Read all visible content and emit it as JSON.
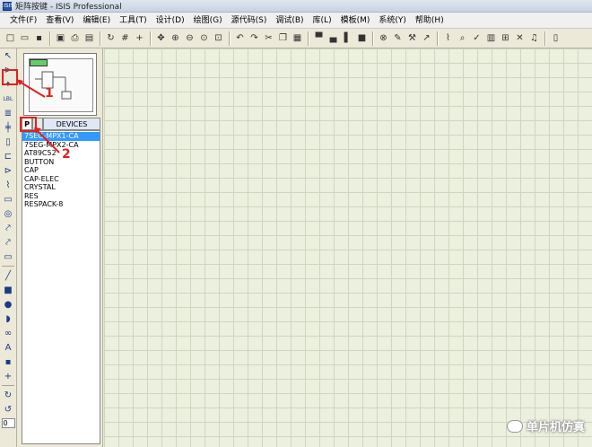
{
  "window": {
    "icon_text": "ISIS",
    "title": "矩阵按键 - ISIS Professional"
  },
  "menubar": {
    "items": [
      "文件(F)",
      "查看(V)",
      "编辑(E)",
      "工具(T)",
      "设计(D)",
      "绘图(G)",
      "源代码(S)",
      "调试(B)",
      "库(L)",
      "模板(M)",
      "系统(Y)",
      "帮助(H)"
    ]
  },
  "toolbar": {
    "icons": [
      [
        "new-file-icon",
        "□"
      ],
      [
        "open-folder-icon",
        "▭"
      ],
      [
        "save-icon",
        "▪"
      ],
      "sep",
      [
        "import-icon",
        "▣"
      ],
      [
        "print-icon",
        "⎙"
      ],
      [
        "print-area-icon",
        "▤"
      ],
      "sep",
      [
        "refresh-icon",
        "↻"
      ],
      [
        "grid-icon",
        "#"
      ],
      [
        "origin-icon",
        "+"
      ],
      "sep",
      [
        "pan-icon",
        "✥"
      ],
      [
        "zoom-in-icon",
        "⊕"
      ],
      [
        "zoom-out-icon",
        "⊖"
      ],
      [
        "zoom-all-icon",
        "⊙"
      ],
      [
        "zoom-area-icon",
        "⊡"
      ],
      "sep",
      [
        "undo-icon",
        "↶"
      ],
      [
        "redo-icon",
        "↷"
      ],
      [
        "cut-icon",
        "✂"
      ],
      [
        "copy-icon",
        "❐"
      ],
      [
        "paste-icon",
        "▦"
      ],
      "sep",
      [
        "block-copy-icon",
        "▀"
      ],
      [
        "block-move-icon",
        "▄"
      ],
      [
        "block-rotate-icon",
        "▌"
      ],
      [
        "block-delete-icon",
        "■"
      ],
      "sep",
      [
        "pick-icon",
        "⊗"
      ],
      [
        "make-device-icon",
        "✎"
      ],
      [
        "package-icon",
        "⚒"
      ],
      [
        "decompose-icon",
        "↗"
      ],
      "sep",
      [
        "wire-autorouter-icon",
        "⌇"
      ],
      [
        "search-tag-icon",
        "⌕"
      ],
      [
        "property-tool-icon",
        "✓"
      ],
      [
        "design-explorer-icon",
        "▥"
      ],
      [
        "new-sheet-icon",
        "⊞"
      ],
      [
        "delete-sheet-icon",
        "✕"
      ],
      [
        "goto-sheet-icon",
        "♫"
      ],
      "sep",
      [
        "bom-icon",
        "▯"
      ]
    ]
  },
  "left_toolbar": {
    "icons": [
      [
        "select-mode-icon",
        "↖"
      ],
      [
        "component-mode-icon",
        "⊳"
      ],
      [
        "junction-icon",
        "✦"
      ],
      [
        "wire-label-icon",
        "LBL"
      ],
      [
        "text-script-icon",
        "≣"
      ],
      [
        "bus-icon",
        "╪"
      ],
      [
        "subcircuit-icon",
        "▯"
      ],
      [
        "terminal-icon",
        "⊏"
      ],
      [
        "device-pin-icon",
        "⊳"
      ],
      [
        "graph-icon",
        "⌇"
      ],
      [
        "tape-recorder-icon",
        "▭"
      ],
      [
        "generator-icon",
        "◎"
      ],
      [
        "voltage-probe-icon",
        "⤤"
      ],
      [
        "current-probe-icon",
        "⤤"
      ],
      [
        "virtual-instrument-icon",
        "▭"
      ],
      "sep",
      [
        "line-icon",
        "╱"
      ],
      [
        "box-icon",
        "■"
      ],
      [
        "circle-icon",
        "●"
      ],
      [
        "arc-icon",
        "◗"
      ],
      [
        "path-icon",
        "∞"
      ],
      [
        "text-icon",
        "A"
      ],
      [
        "symbol-icon",
        "▪"
      ],
      [
        "marker-icon",
        "+"
      ],
      "sep",
      [
        "rotate-cw-icon",
        "↻"
      ],
      [
        "rotate-ccw-icon",
        "↺"
      ]
    ],
    "rotation_value": "0"
  },
  "panel": {
    "p_button": "P",
    "devices_label": "DEVICES",
    "devices": [
      "7SEG-MPX1-CA",
      "7SEG-MPX2-CA",
      "AT89C52",
      "BUTTON",
      "CAP",
      "CAP-ELEC",
      "CRYSTAL",
      "RES",
      "RESPACK-8"
    ],
    "selected_index": 0
  },
  "annotations": {
    "label_1": "1",
    "label_2": "2",
    "color": "#e02020"
  },
  "watermark": {
    "text": "单片机仿真"
  },
  "colors": {
    "canvas_bg": "#ecf0df",
    "grid_line": "#cfd6bd",
    "selection": "#3399ff"
  }
}
